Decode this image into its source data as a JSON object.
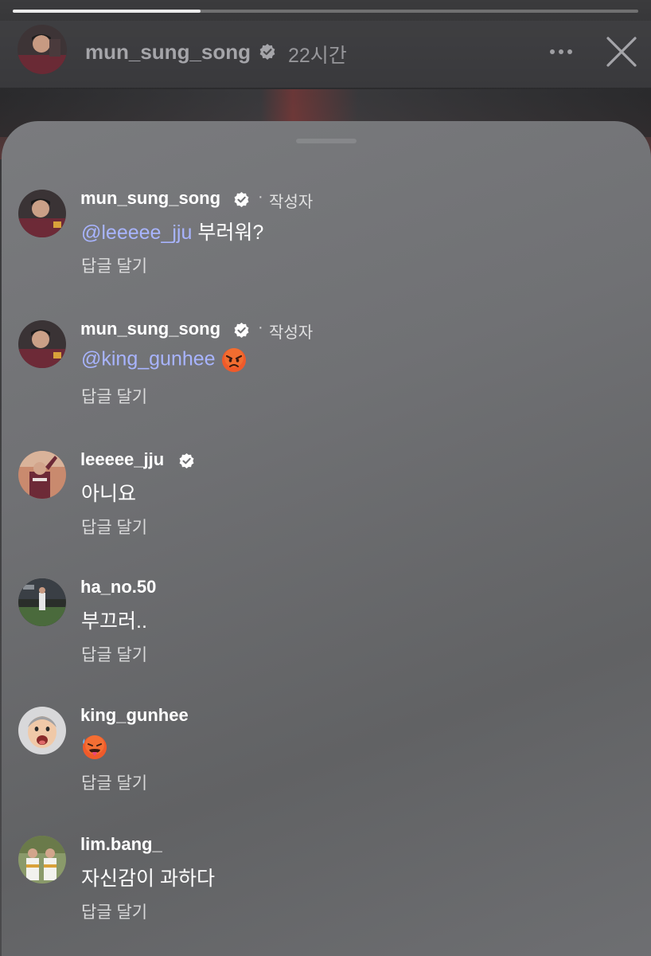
{
  "story": {
    "progress": 0.3,
    "username": "mun_sung_song",
    "verified": true,
    "time_ago": "22시간",
    "more_icon": "more-horizontal-icon",
    "close_icon": "close-icon"
  },
  "comments": [
    {
      "username": "mun_sung_song",
      "verified": true,
      "author_dot": "·",
      "author_label": "작성자",
      "mention": "@leeeee_jju",
      "text": " 부러워?",
      "reply_label": "답글 달기"
    },
    {
      "username": "mun_sung_song",
      "verified": true,
      "author_dot": "·",
      "author_label": "작성자",
      "mention": "@king_gunhee",
      "text": " ",
      "emoji": "angry-face-emoji",
      "reply_label": "답글 달기"
    },
    {
      "username": "leeeee_jju",
      "verified": true,
      "text": "아니요",
      "reply_label": "답글 달기"
    },
    {
      "username": "ha_no.50",
      "verified": false,
      "text": "부끄러..",
      "reply_label": "답글 달기"
    },
    {
      "username": "king_gunhee",
      "verified": false,
      "text": "",
      "emoji": "hot-face-emoji",
      "reply_label": "답글 달기"
    },
    {
      "username": "lim.bang_",
      "verified": false,
      "text": "자신감이 과하다",
      "reply_label": "답글 달기"
    }
  ],
  "colors": {
    "mention": "#a8b4ff",
    "sheet": "#707174",
    "text": "#ffffff"
  }
}
